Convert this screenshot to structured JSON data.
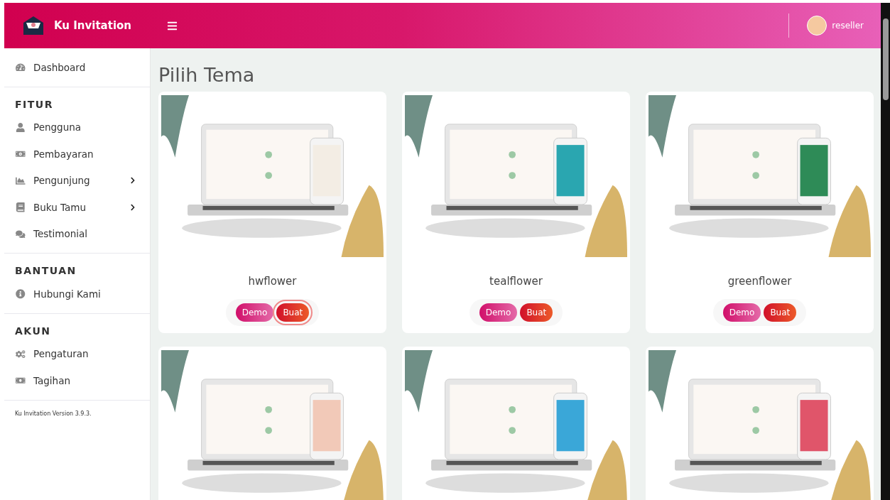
{
  "header": {
    "brand": "Ku Invitation",
    "user": "reseller"
  },
  "sidebar": {
    "sections": [
      {
        "items": [
          {
            "label": "Dashboard",
            "expandable": false
          }
        ]
      },
      {
        "heading": "FITUR",
        "items": [
          {
            "label": "Pengguna",
            "expandable": false
          },
          {
            "label": "Pembayaran",
            "expandable": false
          },
          {
            "label": "Pengunjung",
            "expandable": true
          },
          {
            "label": "Buku Tamu",
            "expandable": true
          },
          {
            "label": "Testimonial",
            "expandable": false
          }
        ]
      },
      {
        "heading": "BANTUAN",
        "items": [
          {
            "label": "Hubungi Kami",
            "expandable": false
          }
        ]
      },
      {
        "heading": "AKUN",
        "items": [
          {
            "label": "Pengaturan",
            "expandable": false
          },
          {
            "label": "Tagihan",
            "expandable": false
          }
        ]
      }
    ],
    "version": "Ku Invitation Version 3.9.3."
  },
  "page": {
    "title": "Pilih Tema"
  },
  "themes": [
    {
      "name": "hwflower",
      "color": "#f3ede4",
      "buttons": [
        {
          "label": "Demo",
          "kind": "demo",
          "focused": false
        },
        {
          "label": "Buat",
          "kind": "create",
          "focused": true
        }
      ]
    },
    {
      "name": "tealflower",
      "color": "#2aa6b0",
      "buttons": [
        {
          "label": "Demo",
          "kind": "demo",
          "focused": false
        },
        {
          "label": "Buat",
          "kind": "create",
          "focused": false
        }
      ]
    },
    {
      "name": "greenflower",
      "color": "#2e8b57",
      "buttons": [
        {
          "label": "Demo",
          "kind": "demo",
          "focused": false
        },
        {
          "label": "Buat",
          "kind": "create",
          "focused": false
        }
      ]
    },
    {
      "color": "#f2c9b8"
    },
    {
      "color": "#3aa7d8"
    },
    {
      "color": "#e0556a"
    }
  ]
}
